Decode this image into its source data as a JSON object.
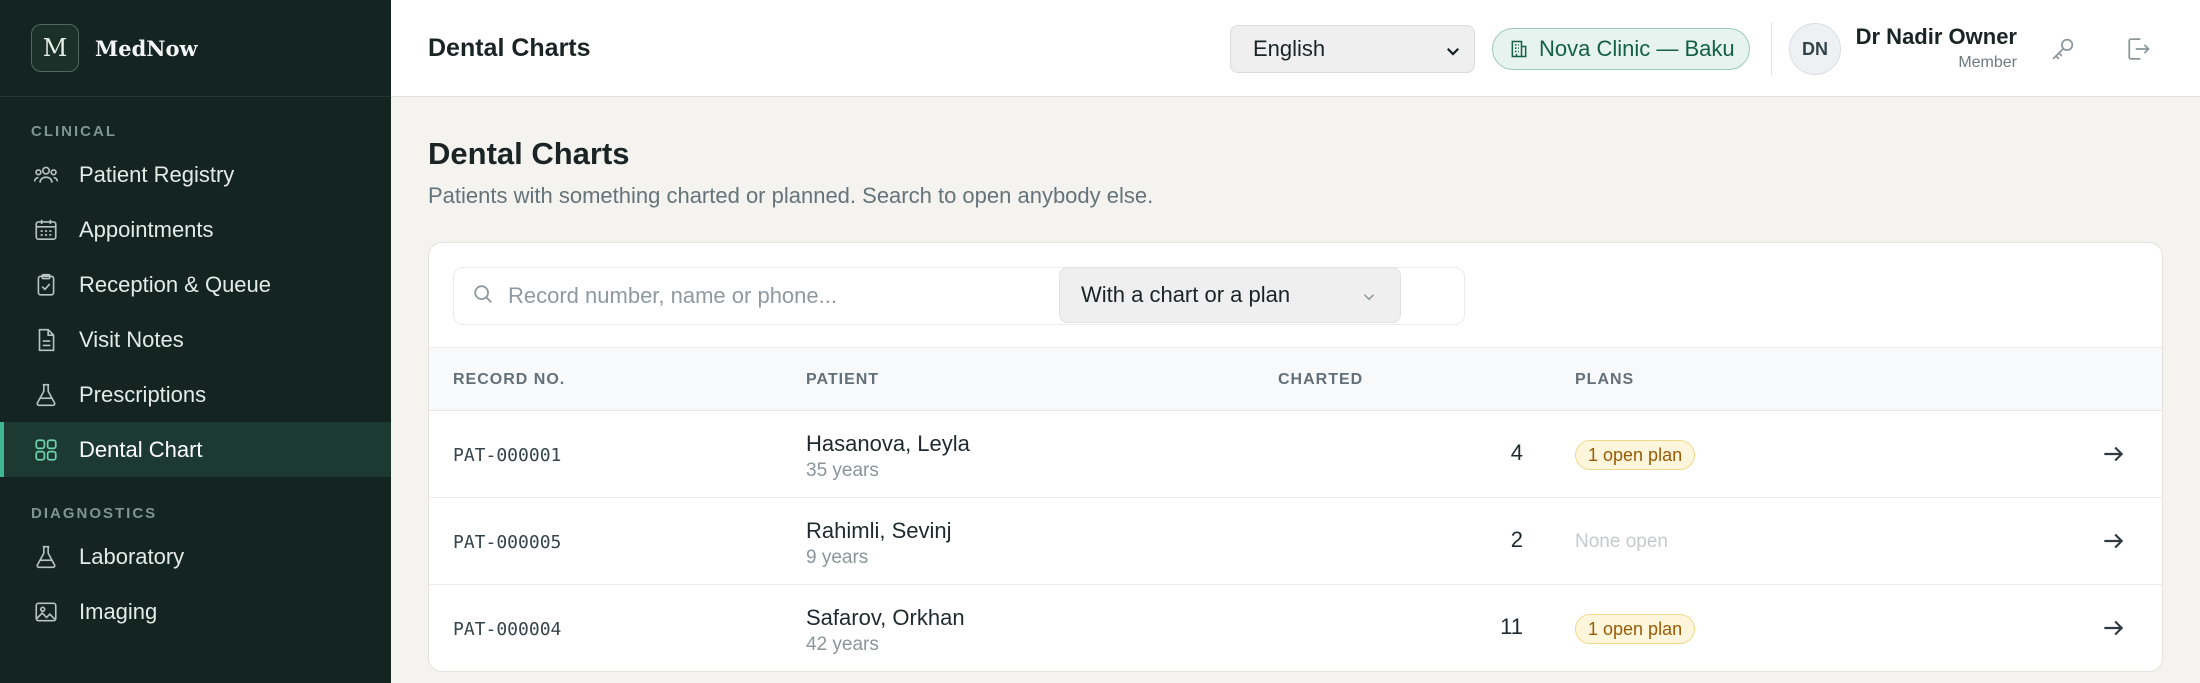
{
  "brand": {
    "logo_letter": "M",
    "name": "MedNow"
  },
  "sidebar": {
    "sections": [
      {
        "label": "CLINICAL"
      },
      {
        "label": "DIAGNOSTICS"
      }
    ],
    "clinical_items": [
      {
        "label": "Patient Registry",
        "icon": "users-icon"
      },
      {
        "label": "Appointments",
        "icon": "calendar-icon"
      },
      {
        "label": "Reception & Queue",
        "icon": "clipboard-check-icon"
      },
      {
        "label": "Visit Notes",
        "icon": "document-icon"
      },
      {
        "label": "Prescriptions",
        "icon": "flask-icon"
      },
      {
        "label": "Dental Chart",
        "icon": "grid-icon",
        "active": true
      }
    ],
    "diagnostics_items": [
      {
        "label": "Laboratory",
        "icon": "flask-icon"
      },
      {
        "label": "Imaging",
        "icon": "image-icon"
      }
    ]
  },
  "header": {
    "title": "Dental Charts",
    "language": {
      "selected": "English"
    },
    "clinic": "Nova Clinic — Baku",
    "user": {
      "initials": "DN",
      "name": "Dr Nadir Owner",
      "role": "Member"
    }
  },
  "main": {
    "title": "Dental Charts",
    "subtitle": "Patients with something charted or planned. Search to open anybody else.",
    "search": {
      "placeholder": "Record number, name or phone...",
      "value": ""
    },
    "filter": {
      "selected": "With a chart or a plan"
    },
    "table": {
      "columns": [
        "RECORD NO.",
        "PATIENT",
        "CHARTED",
        "PLANS"
      ],
      "rows": [
        {
          "record": "PAT-000001",
          "name": "Hasanova, Leyla",
          "age": "35 years",
          "charted": "4",
          "plans": "1 open plan",
          "has_open": true
        },
        {
          "record": "PAT-000005",
          "name": "Rahimli, Sevinj",
          "age": "9 years",
          "charted": "2",
          "plans": "None open",
          "has_open": false
        },
        {
          "record": "PAT-000004",
          "name": "Safarov, Orkhan",
          "age": "42 years",
          "charted": "11",
          "plans": "1 open plan",
          "has_open": true
        }
      ]
    }
  },
  "colors": {
    "sidebar_bg": "#142420",
    "accent": "#3fb592",
    "clinic_badge": "#136047",
    "plan_badge": "#9a5a06"
  }
}
